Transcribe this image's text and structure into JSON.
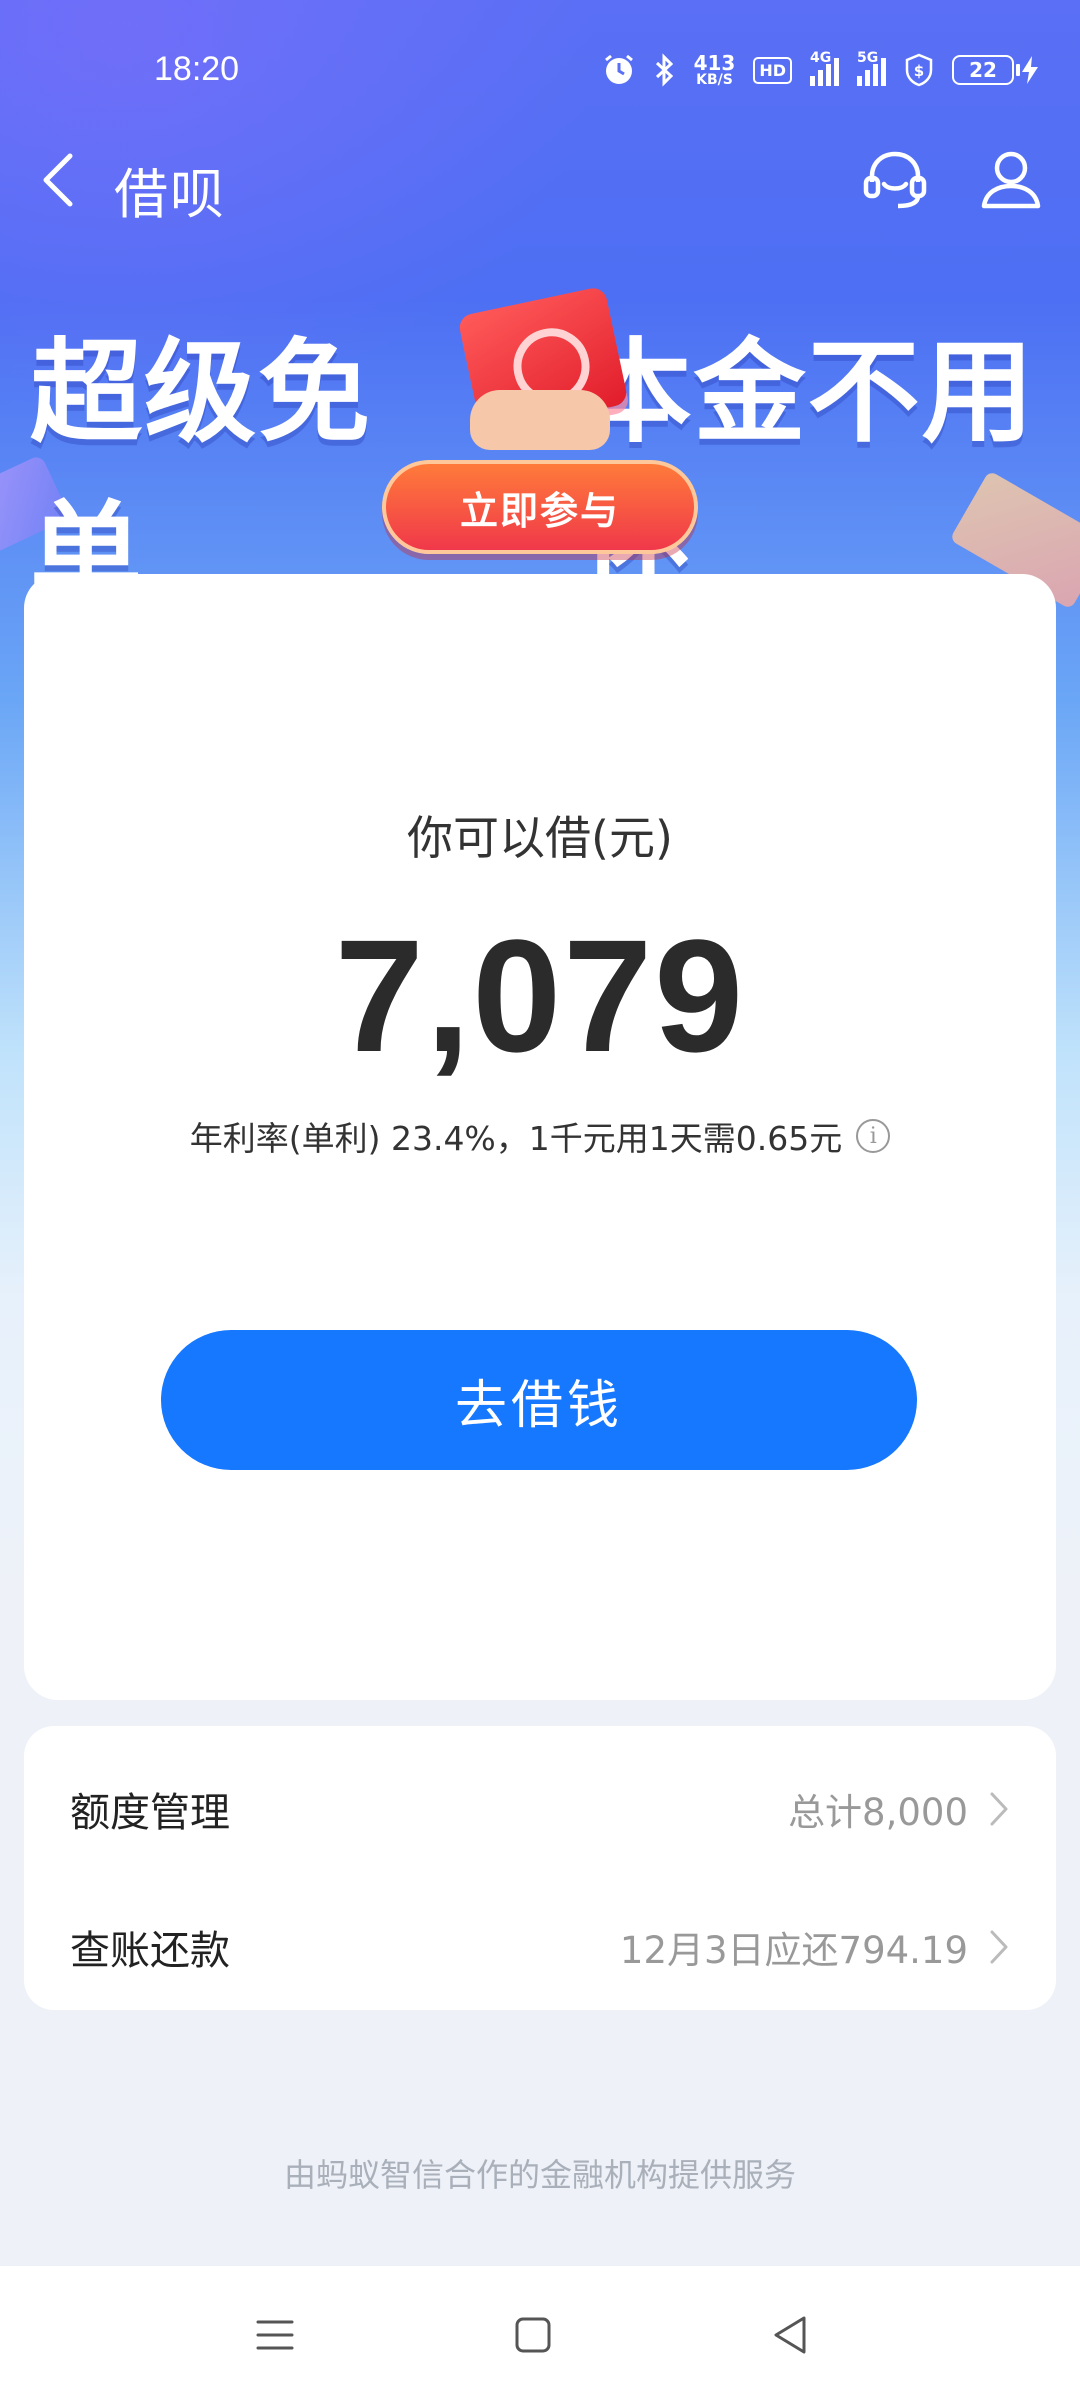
{
  "status_bar": {
    "time": "18:20",
    "net_speed_value": "413",
    "net_speed_unit": "KB/S",
    "hd_label": "HD",
    "sig1_label": "4G",
    "sig2_label": "5G",
    "battery": "22"
  },
  "nav": {
    "title": "借呗"
  },
  "banner": {
    "headline_left": "超级免单",
    "headline_right": "本金不用还",
    "cta": "立即参与"
  },
  "main_card": {
    "lend_label": "你可以借(元)",
    "amount": "7,079",
    "rate_text": "年利率(单利) 23.4%，1千元用1天需0.65元",
    "info_icon_glyph": "i",
    "borrow_button": "去借钱"
  },
  "list": {
    "items": [
      {
        "label": "额度管理",
        "value": "总计8,000"
      },
      {
        "label": "查账还款",
        "value": "12月3日应还794.19"
      }
    ]
  },
  "footer": {
    "note": "由蚂蚁智信合作的金融机构提供服务"
  },
  "colors": {
    "primary": "#1677ff",
    "cta_red": "#f0384a"
  },
  "icons": {
    "back": "back-arrow-icon",
    "service": "customer-service-icon",
    "user": "user-icon",
    "info": "info-icon",
    "chevron": "chevron-right-icon",
    "menu": "menu-icon",
    "home": "home-icon",
    "system_back": "triangle-back-icon"
  }
}
